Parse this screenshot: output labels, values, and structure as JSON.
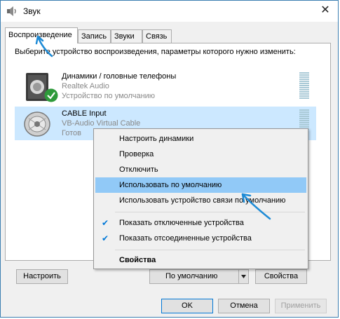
{
  "window": {
    "title": "Звук",
    "close_glyph": "✕"
  },
  "tabs": [
    "Воспроизведение",
    "Запись",
    "Звуки",
    "Связь"
  ],
  "instruction": "Выберите устройство воспроизведения, параметры которого нужно изменить:",
  "devices": [
    {
      "name": "Динамики / головные телефоны",
      "driver": "Realtek Audio",
      "status": "Устройство по умолчанию",
      "icon": "speaker-icon",
      "badge": "default-check-icon"
    },
    {
      "name": "CABLE Input",
      "driver": "VB-Audio Virtual Cable",
      "status": "Готов",
      "icon": "virtual-cable-icon"
    }
  ],
  "context_menu": {
    "items": [
      {
        "label": "Настроить динамики"
      },
      {
        "label": "Проверка"
      },
      {
        "label": "Отключить"
      },
      {
        "label": "Использовать по умолчанию",
        "highlighted": true
      },
      {
        "label": "Использовать устройство связи по умолчанию"
      },
      {
        "label": "Показать отключенные устройства",
        "checked": true
      },
      {
        "label": "Показать отсоединенные устройства",
        "checked": true
      },
      {
        "label": "Свойства",
        "bold": true
      }
    ]
  },
  "buttons": {
    "configure": "Настроить",
    "set_default": "По умолчанию",
    "properties": "Свойства",
    "ok": "OK",
    "cancel": "Отмена",
    "apply": "Применить"
  },
  "colors": {
    "accent": "#0078d7",
    "selection": "#cce8ff",
    "menu_highlight": "#91c9f7",
    "annotation_arrow": "#1e8bd6"
  }
}
